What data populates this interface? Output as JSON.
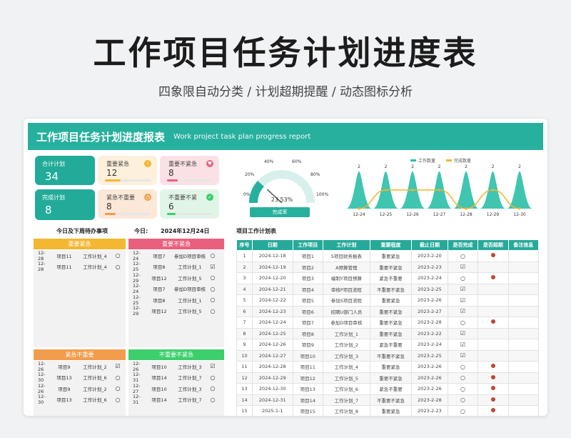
{
  "hero": {
    "title": "工作项目任务计划进度表",
    "subtitle": "四象限自动分类 / 计划超期提醒 / 动态图标分析"
  },
  "banner": {
    "title": "工作项目任务计划进度报表",
    "subtitle_en": "Work project task plan progress report"
  },
  "stats": {
    "total": {
      "label": "合计计划",
      "value": "34"
    },
    "done": {
      "label": "完成计划",
      "value": "8"
    },
    "q1": {
      "label": "重要紧急",
      "value": "12",
      "fill": 0.35,
      "color": "#f4b731",
      "bg": "#fdf0dc"
    },
    "q2": {
      "label": "重要不紧急",
      "value": "8",
      "fill": 0.24,
      "color": "#e9607e",
      "bg": "#fbe1e6"
    },
    "q3": {
      "label": "紧急不重要",
      "value": "8",
      "fill": 0.24,
      "color": "#f19d4d",
      "bg": "#fbe8d8"
    },
    "q4": {
      "label": "不重要不紧",
      "value": "6",
      "fill": 0.18,
      "color": "#3ccf6b",
      "bg": "#e0f5e6"
    }
  },
  "gauge": {
    "ticks": [
      "0%",
      "20%",
      "40%",
      "60%",
      "80%",
      "100%"
    ],
    "value_label": "23.53%",
    "value": 0.2353,
    "button": "完成率"
  },
  "chart_data": {
    "type": "area",
    "categories": [
      "12-24",
      "12-25",
      "12-26",
      "12-27",
      "12-28",
      "12-29",
      "12-30"
    ],
    "series": [
      {
        "name": "工作数量",
        "values": [
          2,
          2,
          2,
          2,
          2,
          2,
          2
        ]
      },
      {
        "name": "完成数量",
        "values": [
          0,
          1,
          1,
          1,
          0,
          1,
          0
        ]
      }
    ],
    "legend": "top",
    "data_labels": [
      "2",
      "2",
      "2",
      "2",
      "2",
      "2",
      "2"
    ]
  },
  "todo": {
    "title": "今日及下周待办事项",
    "date_label": "今日:",
    "date": "2024年12月24日"
  },
  "quadrants": {
    "q1": {
      "head": "重要紧急",
      "rows": [
        [
          "12-28",
          "项目11",
          "工作计划_4",
          "○"
        ],
        [
          "12-28",
          "项目11",
          "工作计划_4",
          "○"
        ]
      ]
    },
    "q2": {
      "head": "重要不紧急",
      "rows": [
        [
          "12-24",
          "项目7",
          "参加D项目审核",
          "○"
        ],
        [
          "12-25",
          "项目8",
          "工作计划_1",
          "☑"
        ],
        [
          "12-29",
          "项目12",
          "工作计划_5",
          "○"
        ],
        [
          "12-24",
          "项目7",
          "参加D项目审核",
          "○"
        ],
        [
          "12-25",
          "项目8",
          "工作计划_1",
          "○"
        ],
        [
          "12-29",
          "项目12",
          "工作计划_5",
          "○"
        ]
      ]
    },
    "q3": {
      "head": "紧急不重要",
      "rows": [
        [
          "12-26",
          "项目9",
          "工作计划_2",
          "☑"
        ],
        [
          "12-30",
          "项目13",
          "工作计划_6",
          "○"
        ],
        [
          "12-26",
          "项目9",
          "工作计划_2",
          "○"
        ],
        [
          "12-30",
          "项目13",
          "工作计划_6",
          "○"
        ]
      ]
    },
    "q4": {
      "head": "不重要不紧急",
      "rows": [
        [
          "12-26",
          "项目10",
          "工作计划_3",
          "☑"
        ],
        [
          "12-31",
          "项目14",
          "工作计划_7",
          "○"
        ],
        [
          "12-27",
          "项目10",
          "工作计划_3",
          "○"
        ],
        [
          "12-31",
          "项目14",
          "工作计划_7",
          "○"
        ]
      ]
    }
  },
  "plan": {
    "title": "项目工作计划表",
    "headers": [
      "序号",
      "日期",
      "工作项目",
      "工作计划",
      "重要程度",
      "截止日期",
      "是否完成",
      "是否超期",
      "备注信息"
    ],
    "rows": [
      [
        "1",
        "2024-12-18",
        "项目1",
        "S项目财务报表",
        "重要紧急",
        "2023-2-20",
        "○",
        "●",
        ""
      ],
      [
        "2",
        "2024-12-19",
        "项目2",
        "A预算管理",
        "重要不紧急",
        "2023-2-23",
        "☑",
        "",
        ""
      ],
      [
        "3",
        "2024-12-20",
        "项目3",
        "编制Y项目预算",
        "紧急不重要",
        "2023-2-24",
        "○",
        "●",
        ""
      ],
      [
        "4",
        "2024-12-21",
        "项目4",
        "审核P项目流程",
        "不重要不紧急",
        "2023-2-25",
        "☑",
        "",
        ""
      ],
      [
        "5",
        "2024-12-22",
        "项目5",
        "参加S项目流程",
        "重要紧急",
        "2023-2-26",
        "☑",
        "",
        ""
      ],
      [
        "6",
        "2024-12-23",
        "项目6",
        "招聘U部门人员",
        "重要不紧急",
        "2023-2-27",
        "☑",
        "",
        ""
      ],
      [
        "7",
        "2024-12-24",
        "项目7",
        "参加D项目审核",
        "重要不紧急",
        "2023-2-28",
        "○",
        "●",
        ""
      ],
      [
        "8",
        "2024-12-25",
        "项目8",
        "工作计划_1",
        "重要不紧急",
        "2023-2-22",
        "☑",
        "",
        ""
      ],
      [
        "9",
        "2024-12-26",
        "项目9",
        "工作计划_2",
        "紧急不重要",
        "2023-2-24",
        "☑",
        "",
        ""
      ],
      [
        "10",
        "2024-12-27",
        "项目10",
        "工作计划_3",
        "不重要不紧急",
        "2023-2-25",
        "☑",
        "",
        ""
      ],
      [
        "11",
        "2024-12-28",
        "项目11",
        "工作计划_4",
        "重要紧急",
        "2023-2-26",
        "○",
        "●",
        ""
      ],
      [
        "12",
        "2024-12-29",
        "项目12",
        "工作计划_5",
        "重要不紧急",
        "2023-2-26",
        "○",
        "●",
        ""
      ],
      [
        "13",
        "2024-12-30",
        "项目13",
        "工作计划_6",
        "紧急不重要",
        "2023-2-26",
        "○",
        "●",
        ""
      ],
      [
        "14",
        "2024-12-31",
        "项目14",
        "工作计划_7",
        "不重要不紧急",
        "2023-2-28",
        "○",
        "●",
        ""
      ],
      [
        "15",
        "2025-1-1",
        "项目15",
        "工作计划_8",
        "重要紧急",
        "2023-2-23",
        "○",
        "●",
        ""
      ]
    ]
  }
}
